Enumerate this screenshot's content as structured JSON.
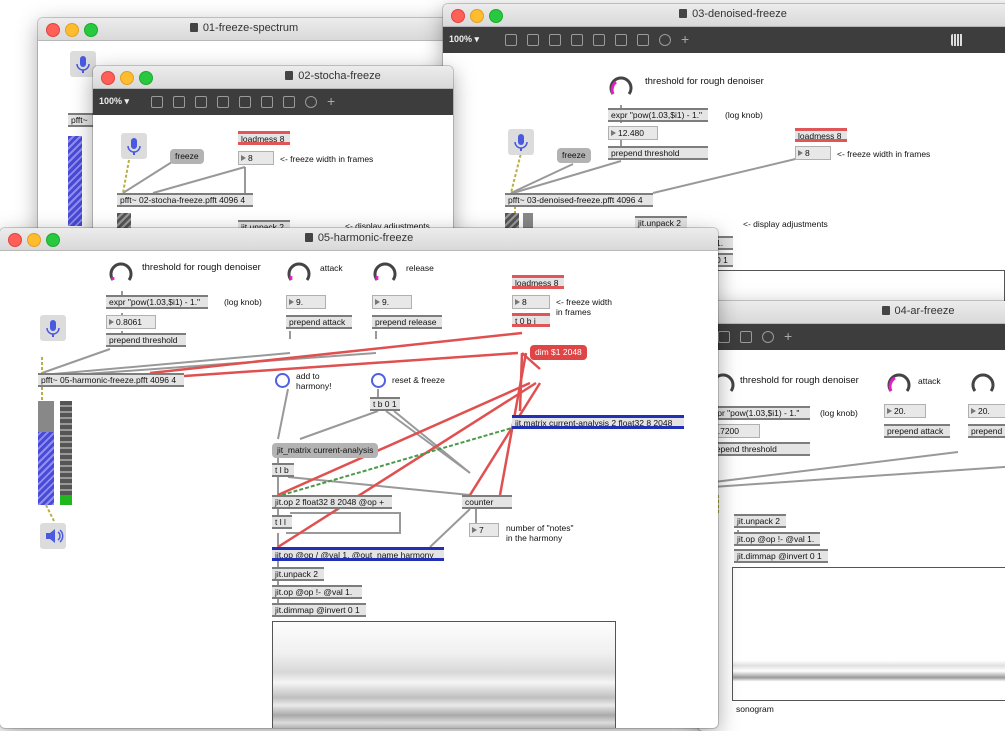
{
  "zoom_label": "100% ▾",
  "windows": {
    "w01": {
      "title": "01-freeze-spectrum"
    },
    "w03": {
      "title": "03-denoised-freeze",
      "knob_label": "threshold for rough denoiser",
      "expr": "expr \"pow(1.03,$i1) - 1.\"",
      "log_knob": "(log knob)",
      "num_value": "12.480",
      "prepend": "prepend threshold",
      "freeze": "freeze",
      "loadmess": "loadmess 8",
      "num8": "8",
      "width_note": "<- freeze width in frames",
      "pfft": "pfft~ 03-denoised-freeze.pfft 4096 4",
      "display_note": "<- display adjustments",
      "unpack": "jit.unpack 2",
      "frag_dim": "1.",
      "frag_01": "0 1"
    },
    "w02": {
      "title": "02-stocha-freeze",
      "freeze": "freeze",
      "loadmess": "loadmess 8",
      "num8": "8",
      "width_note": "<- freeze width in frames",
      "pfft": "pfft~ 02-stocha-freeze.pfft 4096 4",
      "display_note": "<- display adjustments",
      "unpack": "jit.unpack 2",
      "pfft_frag": "pfft~"
    },
    "w04": {
      "title": "04-ar-freeze",
      "knob_label": "threshold for rough denoiser",
      "attack": "attack",
      "expr": "xpr \"pow(1.03,$i1) - 1.\"",
      "log_knob": "(log knob)",
      "num_attack": "20.",
      "num_release": "20.",
      "num_value": "4.7200",
      "prepend_attack": "prepend attack",
      "prepend_release": "prepend",
      "prepend": "repend threshold",
      "unpack": "jit.unpack 2",
      "op": "jit.op @op !- @val 1.",
      "dimmap": "jit.dimmap @invert 0 1",
      "sonogram": "sonogram"
    },
    "w05": {
      "title": "05-harmonic-freeze",
      "knob_label": "threshold for rough denoiser",
      "attack": "attack",
      "release": "release",
      "expr": "expr \"pow(1.03,$i1) - 1.\"",
      "log_knob": "(log knob)",
      "num_value": "0.8061",
      "prepend_threshold": "prepend threshold",
      "num_attack": "9.",
      "num_release": "9.",
      "prepend_attack": "prepend attack",
      "prepend_release": "prepend release",
      "loadmess": "loadmess 8",
      "num8": "8",
      "width_note": "<- freeze width\nin frames",
      "tbi": "t 0 b i",
      "dim": "dim $1 2048",
      "pfft": "pfft~ 05-harmonic-freeze.pfft 4096 4",
      "add_label": "add to\nharmony!",
      "reset_label": "reset & freeze",
      "tb01": "t b 0 1",
      "matrix_right": "jit.matrix current-analysis 2 float32 8 2048",
      "matrix_left": "jit_matrix current-analysis",
      "tlb": "t l b",
      "op2": "jit.op 2 float32 8 2048 @op +",
      "counter": "counter",
      "tll": "t l l",
      "num7": "7",
      "notes_label": "number of \"notes\"\nin the harmony",
      "op_harmony": "jit.op @op / @val 1. @out_name harmony",
      "unpack": "jit.unpack 2",
      "op_inv": "jit.op @op !- @val 1.",
      "dimmap": "jit.dimmap @invert 0 1"
    }
  }
}
